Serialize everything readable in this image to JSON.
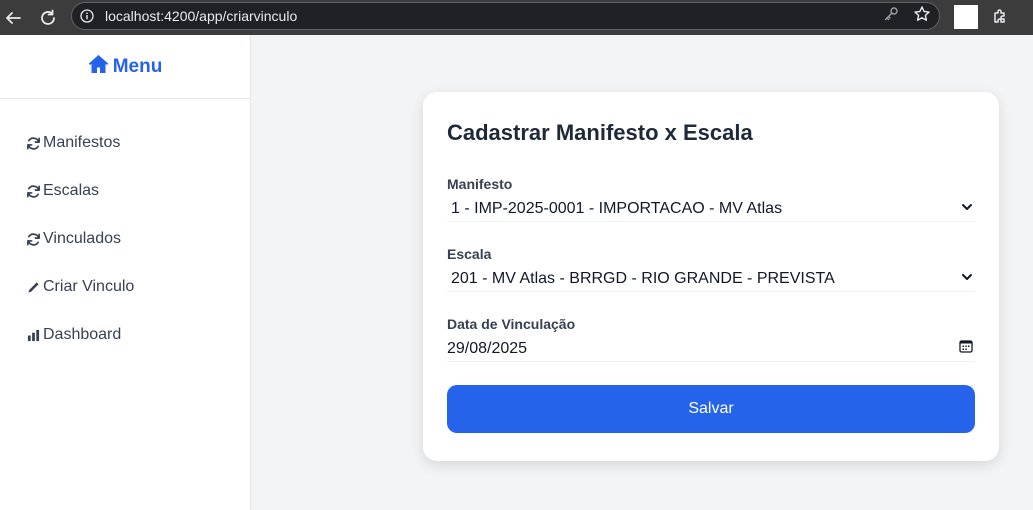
{
  "browser": {
    "url": "localhost:4200/app/criarvinculo",
    "icons": {
      "back": "arrow-left-icon",
      "reload": "reload-icon",
      "info": "info-icon",
      "key": "key-icon",
      "bookmark": "star-icon",
      "extensions": "puzzle-icon"
    }
  },
  "sidebar": {
    "header": {
      "icon": "home-icon",
      "label": "Menu"
    },
    "items": [
      {
        "icon": "refresh-icon",
        "label": "Manifestos"
      },
      {
        "icon": "refresh-icon",
        "label": "Escalas"
      },
      {
        "icon": "refresh-icon",
        "label": "Vinculados"
      },
      {
        "icon": "pencil-icon",
        "label": "Criar Vinculo"
      },
      {
        "icon": "bar-chart-icon",
        "label": "Dashboard"
      }
    ]
  },
  "form": {
    "title": "Cadastrar Manifesto x Escala",
    "manifesto": {
      "label": "Manifesto",
      "value": "1 - IMP-2025-0001 - IMPORTACAO - MV Atlas"
    },
    "escala": {
      "label": "Escala",
      "value": "201 - MV Atlas - BRRGD - RIO GRANDE - PREVISTA"
    },
    "data_vinculacao": {
      "label": "Data de Vinculação",
      "value": "29/08/2025"
    },
    "submit_label": "Salvar"
  },
  "colors": {
    "accent": "#2563eb",
    "background": "#f3f4f6",
    "chrome": "#3c3c3c"
  }
}
